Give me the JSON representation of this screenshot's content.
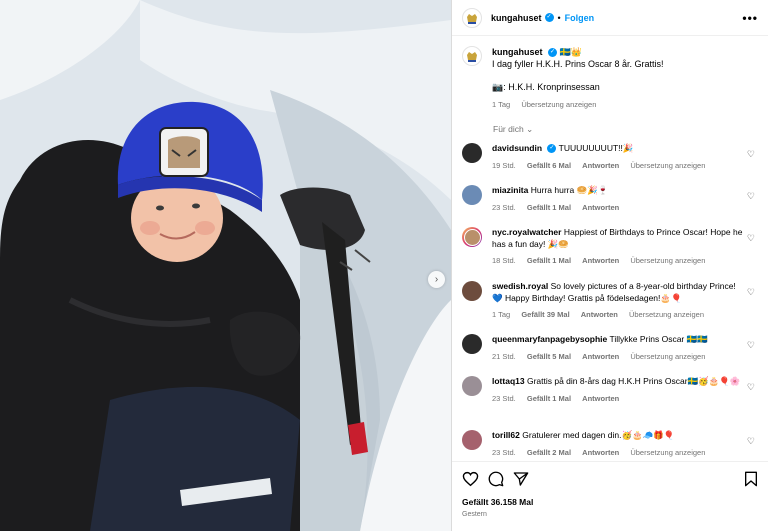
{
  "post": {
    "account": "kungahuset",
    "follow_label": "Folgen",
    "more_label": "•••",
    "separator": "•",
    "caption_flags": "🇸🇪👑",
    "caption_line1": "I dag fyller H.K.H. Prins Oscar 8 år. Grattis!",
    "caption_line2": "📷: H.K.H. Kronprinsessan",
    "caption_time": "1 Tag",
    "caption_translate": "Übersetzung anzeigen",
    "for_you": "Für dich ⌄",
    "likes": "Gefällt 36.158 Mal",
    "date": "Gestern"
  },
  "comments": [
    {
      "user": "davidsundin",
      "verified": true,
      "text": "TUUUUUUUUT!!🎉",
      "time": "19 Std.",
      "likes": "Gefällt 6 Mal",
      "reply": "Antworten",
      "translate": "Übersetzung anzeigen",
      "avatar": "dark"
    },
    {
      "user": "miazinita",
      "verified": false,
      "text": "Hurra hurra 🥯🎉🍷",
      "time": "23 Std.",
      "likes": "Gefällt 1 Mal",
      "reply": "Antworten",
      "translate": "",
      "avatar": "blue"
    },
    {
      "user": "nyc.royalwatcher",
      "verified": false,
      "text": "Happiest of Birthdays to Prince Oscar! Hope he has a fun day! 🎉🥯",
      "time": "18 Std.",
      "likes": "Gefällt 1 Mal",
      "reply": "Antworten",
      "translate": "Übersetzung anzeigen",
      "avatar": "pink"
    },
    {
      "user": "swedish.royal",
      "verified": false,
      "text": "So lovely pictures of a 8-year-old birthday Prince! 💙 Happy Birthday! Grattis på födelsedagen!🎂🎈",
      "time": "1 Tag",
      "likes": "Gefällt 39 Mal",
      "reply": "Antworten",
      "translate": "Übersetzung anzeigen",
      "avatar": "brown"
    },
    {
      "user": "queenmaryfanpagebysophie",
      "verified": false,
      "text": "Tillykke Prins Oscar 🇸🇪🇸🇪",
      "time": "21 Std.",
      "likes": "Gefällt 5 Mal",
      "reply": "Antworten",
      "translate": "Übersetzung anzeigen",
      "avatar": "dark"
    },
    {
      "user": "lottaq13",
      "verified": false,
      "text": "Grattis på din 8-års dag H.K.H Prins Oscar🇸🇪🥳🎂🎈🌸",
      "time": "23 Std.",
      "likes": "Gefällt 1 Mal",
      "reply": "Antworten",
      "translate": "",
      "avatar": "gray"
    },
    {
      "user": "torill62",
      "verified": false,
      "text": "Gratulerer med dagen din.🥳🎂🧢🎁🎈",
      "time": "23 Std.",
      "likes": "Gefällt 2 Mal",
      "reply": "Antworten",
      "translate": "Übersetzung anzeigen",
      "avatar": "purple"
    }
  ],
  "icons": {
    "heart": "heart-icon",
    "comment": "comment-icon",
    "share": "share-icon",
    "save": "bookmark-icon",
    "next": "chevron-right-icon"
  },
  "colors": {
    "link_blue": "#0095f6",
    "meta_gray": "#737373",
    "beanie_blue": "#2a3ec9"
  }
}
